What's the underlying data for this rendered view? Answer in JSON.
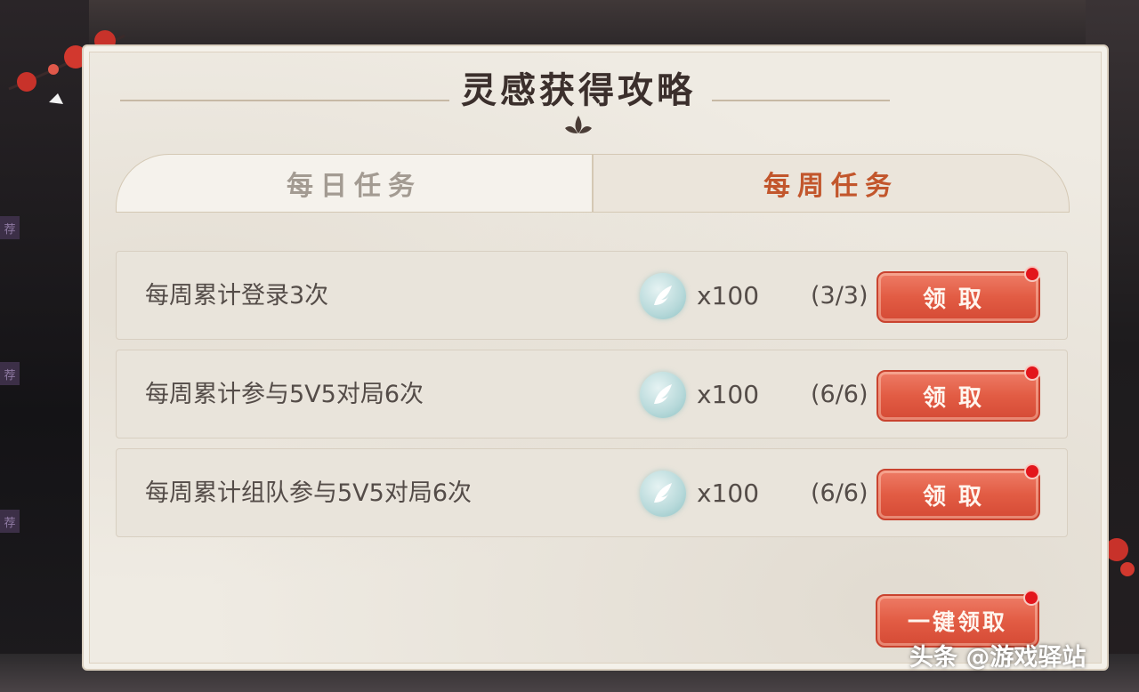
{
  "title": "灵感获得攻略",
  "tabs": [
    {
      "label": "每日任务",
      "active": false
    },
    {
      "label": "每周任务",
      "active": true
    }
  ],
  "tasks": [
    {
      "name": "每周累计登录3次",
      "reward_icon": "inspiration-feather-icon",
      "reward": "x100",
      "progress": "(3/3)",
      "button": "领取"
    },
    {
      "name": "每周累计参与5V5对局6次",
      "reward_icon": "inspiration-feather-icon",
      "reward": "x100",
      "progress": "(6/6)",
      "button": "领取"
    },
    {
      "name": "每周累计组队参与5V5对局6次",
      "reward_icon": "inspiration-feather-icon",
      "reward": "x100",
      "progress": "(6/6)",
      "button": "领取"
    }
  ],
  "claim_all_label": "一键领取",
  "watermark": "头条 @游戏驿站",
  "side_tags": [
    "荐",
    "荐",
    "荐"
  ],
  "colors": {
    "active_tab": "#c2562c",
    "inactive_tab": "#a39b92",
    "button": "#e25c44",
    "badge": "#e3161c",
    "panel": "#efebe3"
  }
}
